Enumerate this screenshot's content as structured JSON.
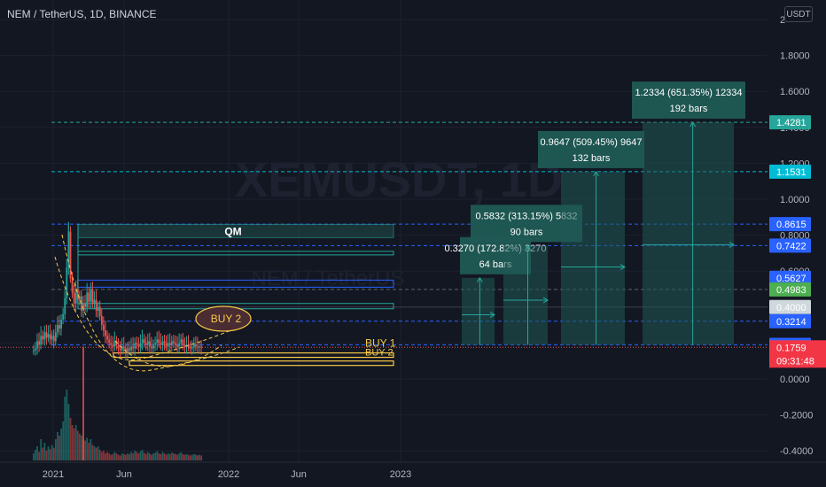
{
  "header": {
    "title": "NEM / TetherUS, 1D, BINANCE",
    "currency": "USDT"
  },
  "watermark": {
    "line1": "XEMUSDT, 1D",
    "line2": "NEM / TetherUS"
  },
  "colors": {
    "background": "#131722",
    "up": "#26a69a",
    "down": "#ef5350",
    "blue_line": "#2962ff",
    "cyan_line": "#00bcd4",
    "teal_line": "#26a69a",
    "yellow": "#f7c948",
    "box_fill": "#1f5a55",
    "buy2_fill": "#4a2c33"
  },
  "chart_data": {
    "type": "candlestick",
    "symbol": "XEMUSDT",
    "interval": "1D",
    "exchange": "BINANCE",
    "y_axis": {
      "ticks": [
        "2",
        "1.8000",
        "1.6000",
        "1.4000",
        "1.2000",
        "1.0000",
        "0.8000",
        "0.6000",
        "0.4000",
        "0.2000",
        "0.0000",
        "-0.2000",
        "-0.4000"
      ],
      "ylim": [
        -0.44,
        2.02
      ]
    },
    "x_axis": {
      "ticks": [
        "2021",
        "Jun",
        "2022",
        "Jun",
        "2023"
      ]
    },
    "current_price": "0.1759",
    "countdown": "09:31:48",
    "price_tags": [
      {
        "label": "1.4281",
        "color": "#26a69a",
        "value": 1.4281
      },
      {
        "label": "1.1531",
        "color": "#00bcd4",
        "value": 1.1531
      },
      {
        "label": "0.8615",
        "color": "#2962ff",
        "value": 0.8615
      },
      {
        "label": "0.7422",
        "color": "#2962ff",
        "value": 0.7422
      },
      {
        "label": "0.5627",
        "color": "#2962ff",
        "value": 0.5627
      },
      {
        "label": "0.4983",
        "color": "#4caf50",
        "value": 0.4983
      },
      {
        "label": "0.4000",
        "color": "#cfd8dc",
        "value": 0.4
      },
      {
        "label": "0.3214",
        "color": "#2962ff",
        "value": 0.3214
      },
      {
        "label": "0.1894",
        "color": "#2962ff",
        "value": 0.1894
      }
    ],
    "horizontal_lines": [
      {
        "value": 1.4281,
        "color": "#26a69a"
      },
      {
        "value": 1.1531,
        "color": "#00bcd4"
      },
      {
        "value": 0.8615,
        "color": "#2962ff"
      },
      {
        "value": 0.7422,
        "color": "#2962ff"
      },
      {
        "value": 0.4983,
        "color": "#5d6270"
      },
      {
        "value": 0.3214,
        "color": "#2962ff"
      },
      {
        "value": 0.1894,
        "color": "#2962ff"
      }
    ],
    "measurements": [
      {
        "line1": "0.3270 (172.82%) 3270",
        "line2": "64 bars",
        "target": 0.5627
      },
      {
        "line1": "0.5832 (313.15%) 5832",
        "line2": "90 bars",
        "target": 0.7422
      },
      {
        "line1": "0.9647 (509.45%) 9647",
        "line2": "132 bars",
        "target": 1.1531
      },
      {
        "line1": "1.2334 (651.35%) 12334",
        "line2": "192 bars",
        "target": 1.4281
      }
    ],
    "annotations": {
      "qm": "QM",
      "buy1": "BUY 1",
      "buy2_right": "BUY 2",
      "buy2_ellipse": "BUY 2"
    },
    "closes": [
      0.16,
      0.17,
      0.21,
      0.19,
      0.24,
      0.22,
      0.26,
      0.23,
      0.25,
      0.22,
      0.24,
      0.21,
      0.26,
      0.3,
      0.28,
      0.33,
      0.36,
      0.45,
      0.62,
      0.82,
      0.56,
      0.48,
      0.42,
      0.5,
      0.44,
      0.46,
      0.38,
      0.42,
      0.4,
      0.48,
      0.43,
      0.5,
      0.42,
      0.44,
      0.38,
      0.4,
      0.35,
      0.3,
      0.27,
      0.24,
      0.22,
      0.2,
      0.19,
      0.18,
      0.21,
      0.19,
      0.17,
      0.16,
      0.18,
      0.17,
      0.15,
      0.17,
      0.16,
      0.18,
      0.17,
      0.2,
      0.19,
      0.18,
      0.2,
      0.22,
      0.2,
      0.19,
      0.21,
      0.18,
      0.17,
      0.19,
      0.2,
      0.22,
      0.2,
      0.19,
      0.21,
      0.2,
      0.18,
      0.2,
      0.19,
      0.21,
      0.2,
      0.19,
      0.18,
      0.2,
      0.22,
      0.19,
      0.18,
      0.19,
      0.18,
      0.17,
      0.18,
      0.19,
      0.18,
      0.175,
      0.18,
      0.176
    ],
    "volumes": [
      0.1,
      0.15,
      0.2,
      0.12,
      0.3,
      0.18,
      0.25,
      0.14,
      0.2,
      0.16,
      0.22,
      0.18,
      0.3,
      0.4,
      0.35,
      0.45,
      0.55,
      0.9,
      1.0,
      0.8,
      0.6,
      0.5,
      0.45,
      0.5,
      0.42,
      0.38,
      0.35,
      0.3,
      0.28,
      0.32,
      0.25,
      0.3,
      0.22,
      0.2,
      0.18,
      0.2,
      0.15,
      0.12,
      0.14,
      0.1,
      0.12,
      0.1,
      0.08,
      0.09,
      0.12,
      0.1,
      0.08,
      0.07,
      0.1,
      0.09,
      0.08,
      0.1,
      0.09,
      0.12,
      0.1,
      0.14,
      0.12,
      0.1,
      0.13,
      0.15,
      0.11,
      0.09,
      0.12,
      0.1,
      0.08,
      0.1,
      0.11,
      0.13,
      0.1,
      0.09,
      0.12,
      0.1,
      0.08,
      0.1,
      0.09,
      0.11,
      0.1,
      0.09,
      0.08,
      0.1,
      0.12,
      0.09,
      0.08,
      0.09,
      0.08,
      0.07,
      0.08,
      0.09,
      0.08,
      0.07,
      0.08,
      0.07
    ]
  }
}
